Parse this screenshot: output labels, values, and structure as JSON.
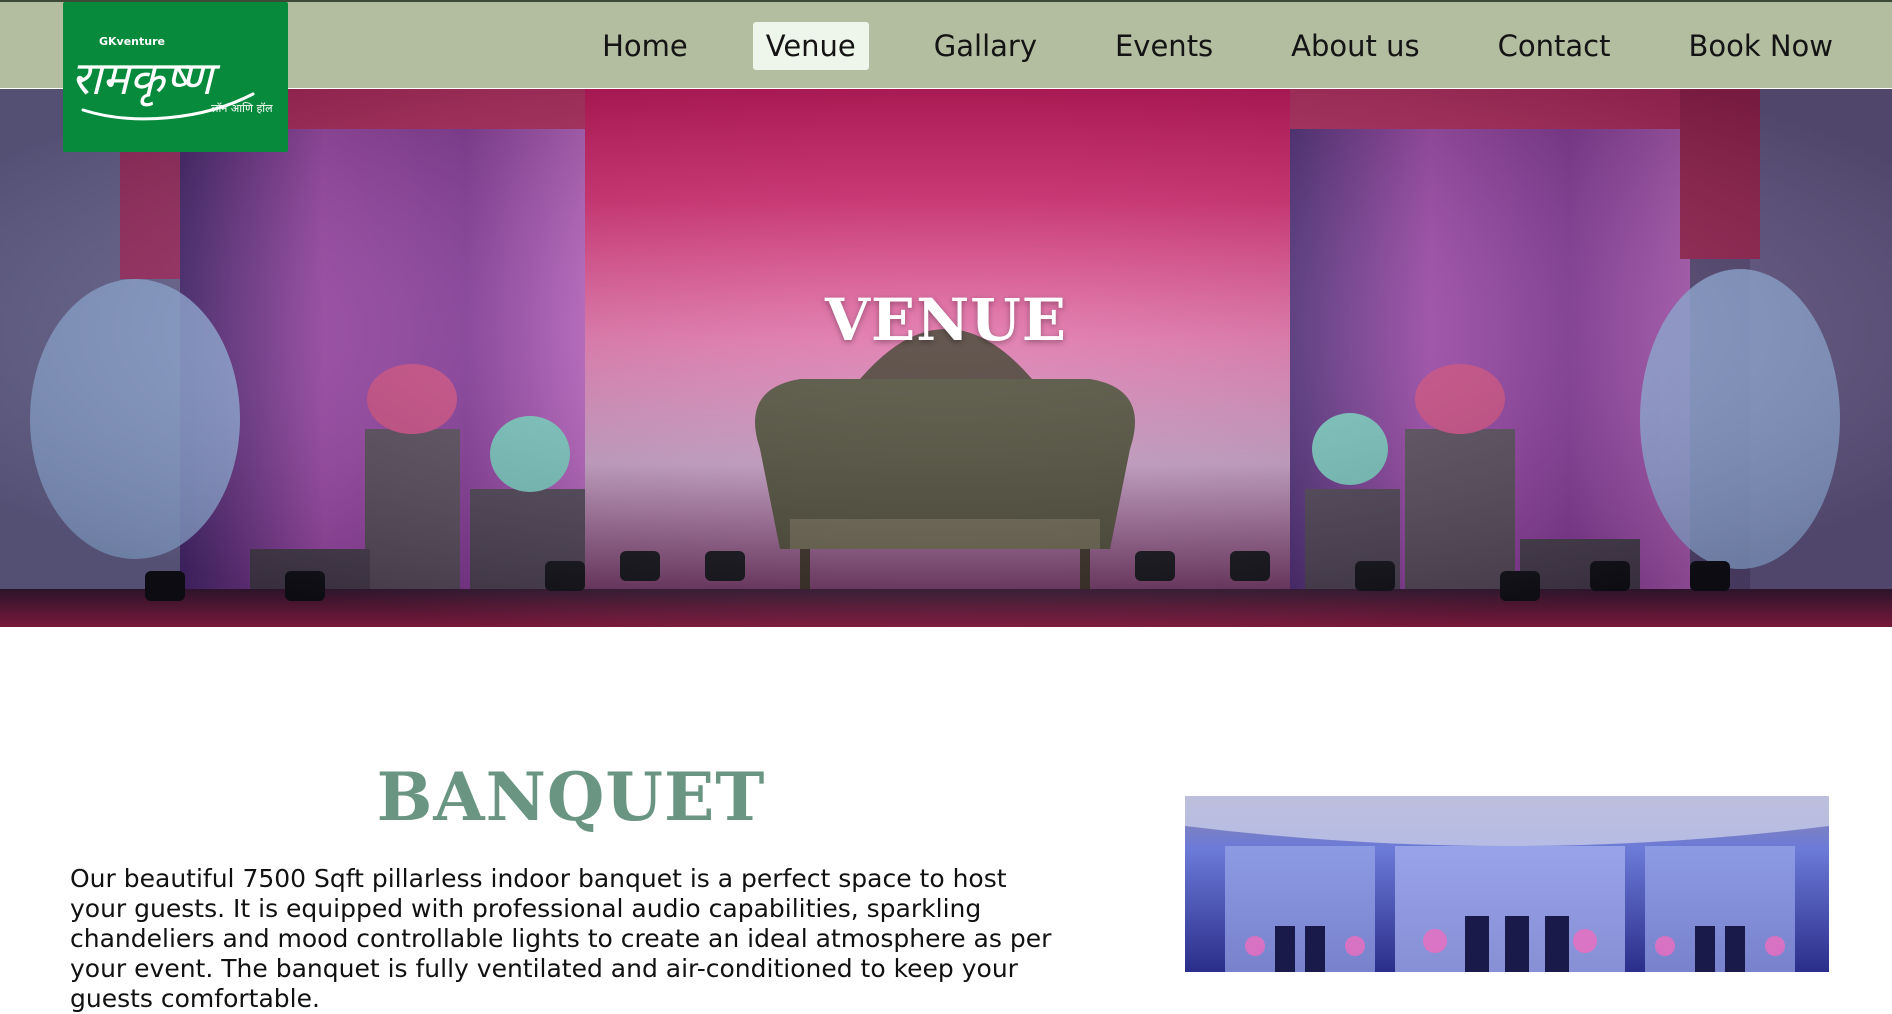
{
  "logo": {
    "brand_small": "GKventure",
    "brand_main": "रामकृष्ण",
    "brand_sub": "लॉन आणि हॉल"
  },
  "nav": {
    "items": [
      {
        "label": "Home",
        "active": false
      },
      {
        "label": "Venue",
        "active": true
      },
      {
        "label": "Gallary",
        "active": false
      },
      {
        "label": "Events",
        "active": false
      },
      {
        "label": "About us",
        "active": false
      },
      {
        "label": "Contact",
        "active": false
      },
      {
        "label": "Book Now",
        "active": false
      }
    ]
  },
  "hero": {
    "title": "VENUE"
  },
  "banquet": {
    "title": "BANQUET",
    "description": "Our beautiful 7500 Sqft pillarless indoor banquet is a perfect space to host your guests. It is equipped with professional audio capabilities, sparkling chandeliers and mood controllable lights to create an ideal atmosphere as per your event. The banquet is fully ventilated and air-conditioned to keep your guests comfortable."
  },
  "colors": {
    "nav_bg": "#b3bda0",
    "logo_bg": "#078a3c",
    "active_tab_bg": "#eef5ea",
    "section_title": "#6a9582"
  }
}
